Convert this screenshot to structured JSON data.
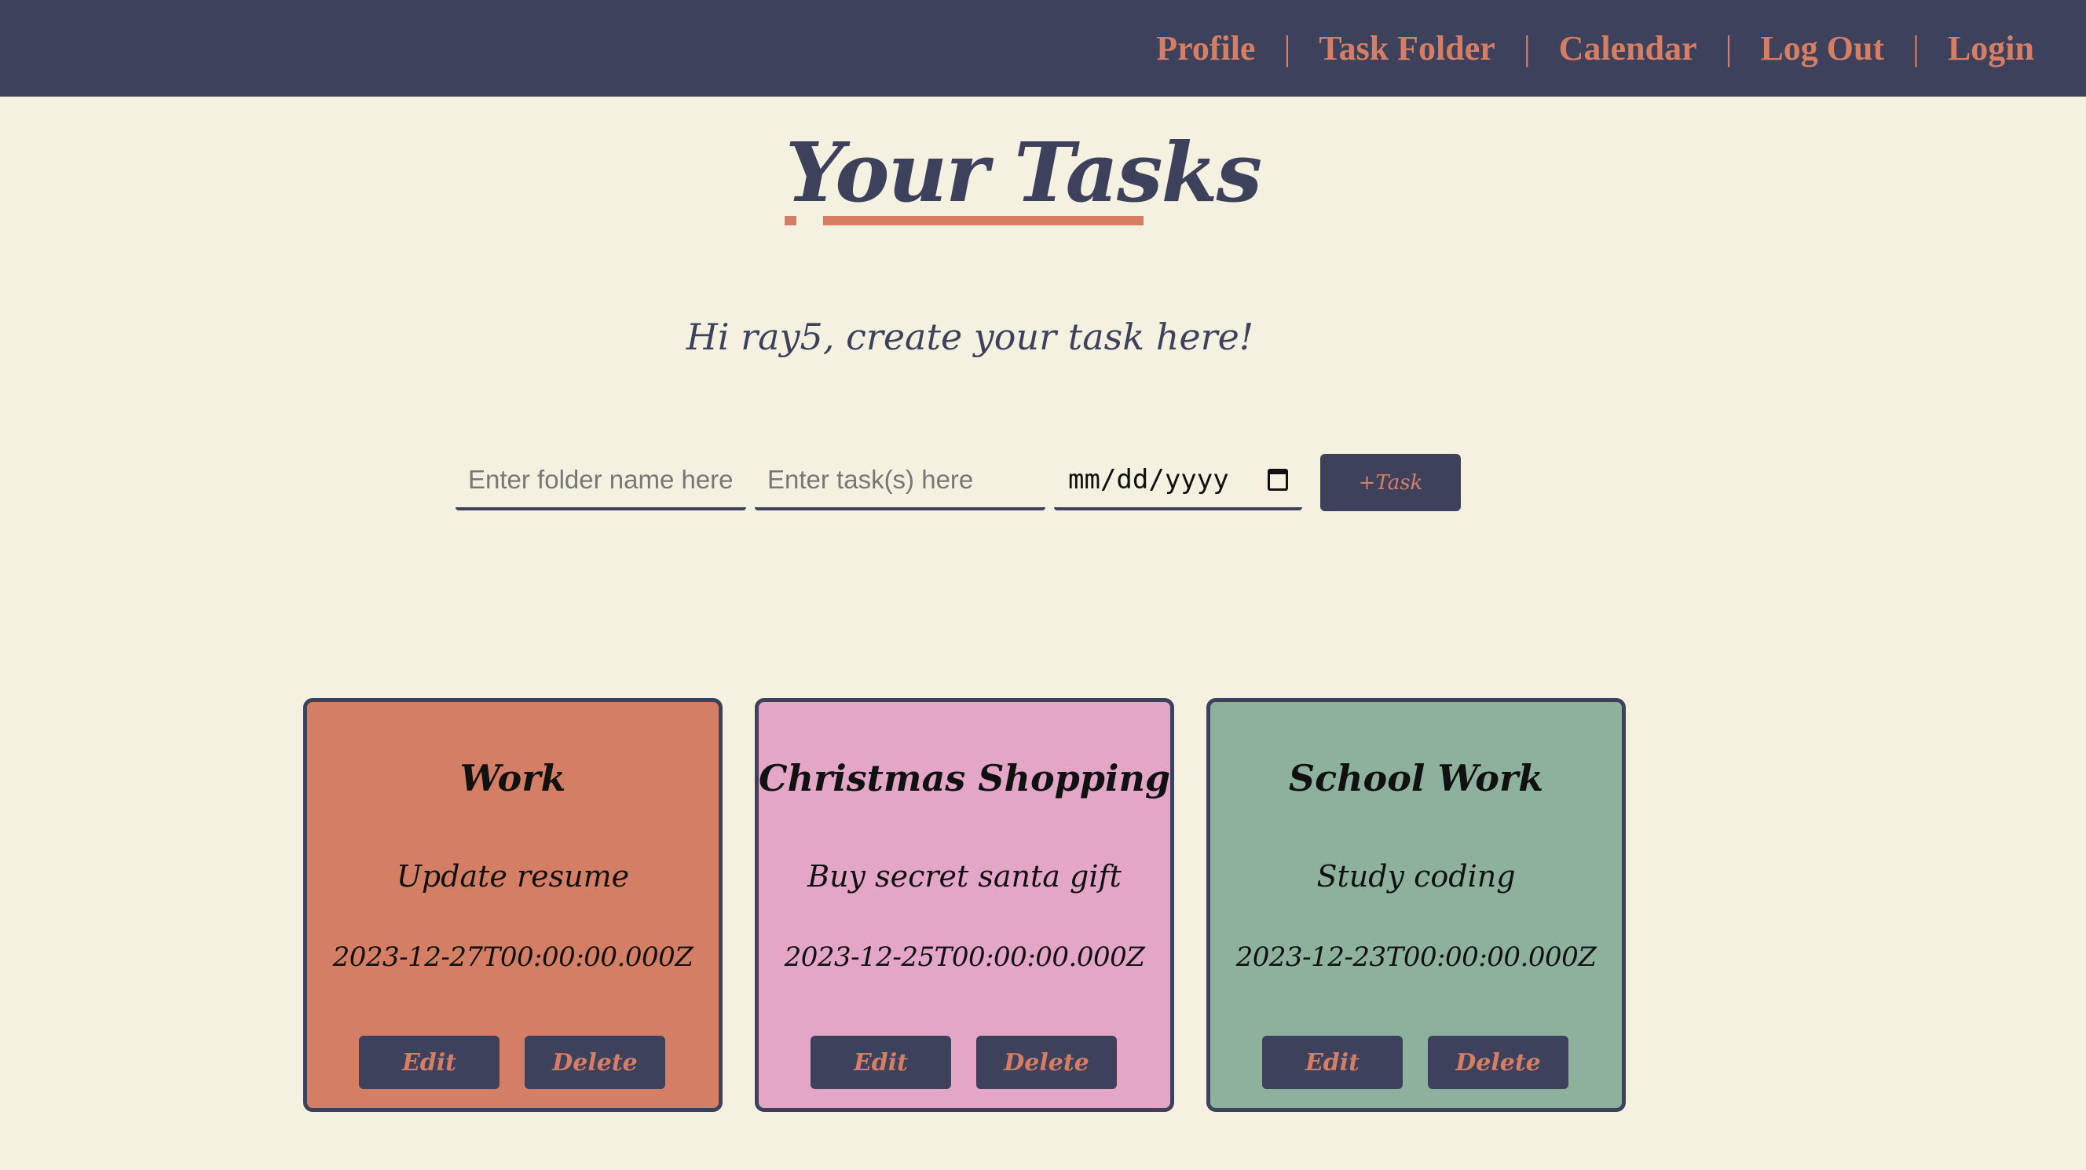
{
  "nav": {
    "links": [
      "Profile",
      "Task Folder",
      "Calendar",
      "Log Out",
      "Login"
    ],
    "separator": "|",
    "text_color": "#d67e63",
    "background": "#3d415c"
  },
  "page": {
    "title": "Your Tasks",
    "greeting": "Hi ray5, create your task here!",
    "background": "#f5f1e1"
  },
  "form": {
    "folder_placeholder": "Enter folder name here",
    "task_placeholder": "Enter task(s) here",
    "date_placeholder": "mm/dd/yyyy",
    "add_button": "+Task"
  },
  "cards": [
    {
      "folder": "Work",
      "task": "Update resume",
      "date": "2023-12-27T00:00:00.000Z",
      "color": "#d47f65",
      "edit_label": "Edit",
      "delete_label": "Delete"
    },
    {
      "folder": "Christmas Shopping",
      "task": "Buy secret santa gift",
      "date": "2023-12-25T00:00:00.000Z",
      "color": "#e3a6c6",
      "edit_label": "Edit",
      "delete_label": "Delete"
    },
    {
      "folder": "School Work",
      "task": "Study coding",
      "date": "2023-12-23T00:00:00.000Z",
      "color": "#8db19d",
      "edit_label": "Edit",
      "delete_label": "Delete"
    }
  ]
}
